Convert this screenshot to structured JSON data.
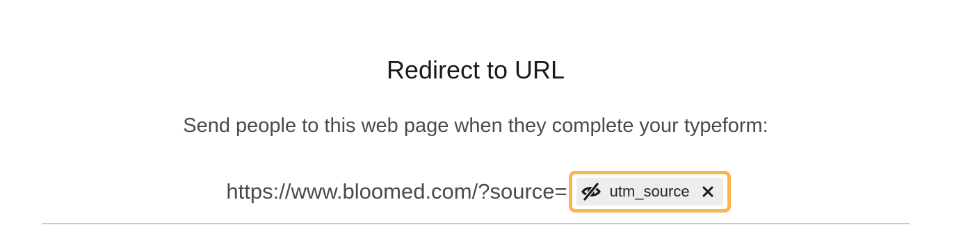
{
  "redirect": {
    "title": "Redirect to URL",
    "description": "Send people to this web page when they complete your typeform:",
    "url_base": "https://www.bloomed.com/?source=",
    "hidden_field": {
      "label": "utm_source",
      "icon": "eye-off-icon",
      "remove_icon": "close-icon"
    }
  },
  "colors": {
    "highlight": "#fbb54a",
    "chip_background": "#ededed",
    "underline": "#c9c9c9"
  }
}
